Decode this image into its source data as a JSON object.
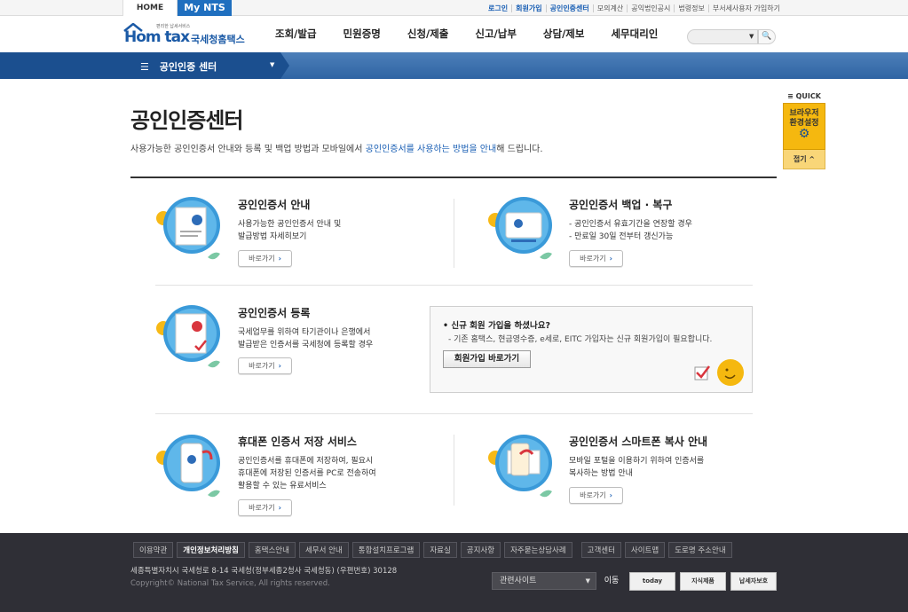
{
  "topbar": {
    "home_tab": "HOME",
    "nts_tab": "My NTS",
    "util_links": [
      "로그인",
      "회원가입",
      "공인인증센터",
      "모의계산",
      "공익법인공시",
      "법령정보",
      "부서세사용자 가입하기"
    ]
  },
  "header": {
    "logo_home": "Hom tax",
    "logo_kr": "국세청홈택스",
    "logo_tiny": "편리한 납세서비스",
    "gnb": [
      "조회/발급",
      "민원증명",
      "신청/제출",
      "신고/납부",
      "상담/제보",
      "세무대리인"
    ],
    "search_button": "🔍"
  },
  "lnb": {
    "menu_icon": "☰",
    "label": "공인인증 센터",
    "drop_icon": "▼"
  },
  "quick": {
    "title": "≡ QUICK",
    "box_label_1": "브라우저",
    "box_label_2": "환경설정",
    "gear_icon": "⚙",
    "close_label": "접기 ^"
  },
  "page": {
    "title": "공인인증센터",
    "desc_pre": "사용가능한 공인인증서 안내와 등록 및 백업 방법과 모바일에서 ",
    "desc_hl": "공인인증서를 사용하는 방법을 안내",
    "desc_post": "해 드립니다."
  },
  "cards": {
    "guide": {
      "title": "공인인증서 안내",
      "lines": [
        "사용가능한 공인인증서 안내 및",
        "발급방법 자세히보기"
      ],
      "button": "바로가기"
    },
    "backup": {
      "title": "공인인증서 백업 · 복구",
      "lines": [
        "- 공인인증서 유효기간을 연장할 경우",
        "- 만료일 30일 전부터 갱신가능"
      ],
      "button": "바로가기"
    },
    "register": {
      "title": "공인인증서 등록",
      "lines": [
        "국세업무를 위하여 타기관이나 은행에서",
        "발급받은 인증서를 국세청에 등록할 경우"
      ],
      "button": "바로가기"
    },
    "phone": {
      "title": "휴대폰 인증서 저장 서비스",
      "lines": [
        "공인인증서를 휴대폰에 저장하여, 필요시",
        "휴대폰에 저장된 인증서를 PC로 전송하여",
        "활용할 수 있는 유료서비스"
      ],
      "button": "바로가기"
    },
    "smartphone": {
      "title": "공인인증서 스마트폰 복사 안내",
      "lines": [
        "모바일 포털을 이용하기 위하여 인증서를",
        "복사하는 방법 안내"
      ],
      "button": "바로가기"
    }
  },
  "join": {
    "question": "• 신규 회원 가입을 하셨나요?",
    "desc": "- 기존 홈택스, 현금영수증, e세로, EITC 가입자는 신규 회원가입이 필요합니다.",
    "button": "회원가입 바로가기"
  },
  "footer": {
    "nav": [
      "이용약관",
      "개인정보처리방침",
      "홈택스안내",
      "세무서 안내",
      "통합설치프로그램",
      "자료실",
      "공지사항",
      "자주묻는상담사례",
      "고객센터",
      "사이트맵",
      "도로명 주소안내"
    ],
    "address": "세종특별자치시 국세청로 8-14 국세청(정부세종2청사 국세청동) (우편번호) 30128",
    "copyright": "Copyright© National Tax Service, All rights reserved.",
    "select_label": "관련사이트",
    "go_label": "이동",
    "badges": [
      "today",
      "지식제품",
      "납세자보호"
    ]
  },
  "colors": {
    "brand_blue": "#1a5fb4",
    "lnb_blue": "#2f64a3",
    "quick_yellow": "#f5b80f",
    "footer_bg": "#2f2f36"
  }
}
